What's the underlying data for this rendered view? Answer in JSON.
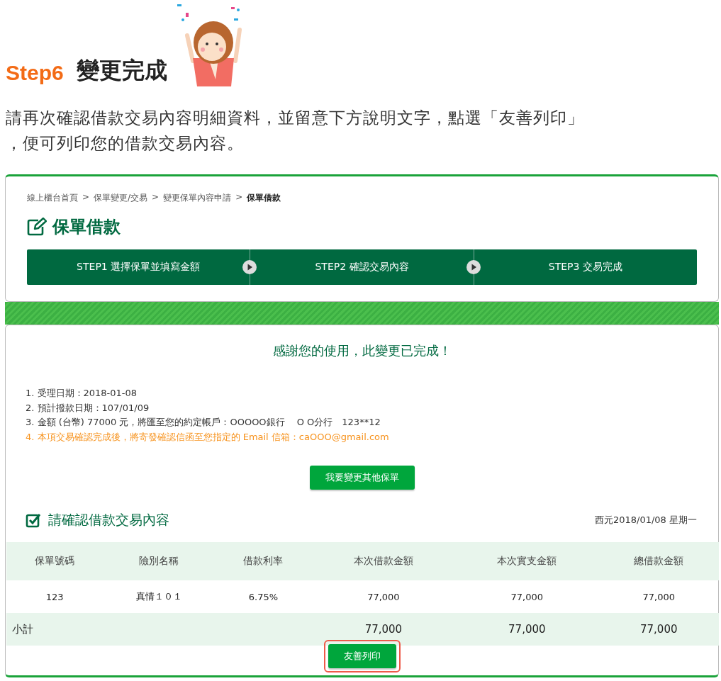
{
  "header": {
    "step": "Step6",
    "title": "變更完成",
    "intro_lines": [
      "請再次確認借款交易內容明細資料，並留意下方說明文字，點選「友善列印」",
      "，便可列印您的借款交易內容。"
    ]
  },
  "breadcrumb": [
    {
      "label": "線上櫃台首頁",
      "current": false
    },
    {
      "label": ">",
      "current": false
    },
    {
      "label": "保單變更/交易",
      "current": false
    },
    {
      "label": ">",
      "current": false
    },
    {
      "label": "變更保單內容申請",
      "current": false
    },
    {
      "label": ">",
      "current": false
    },
    {
      "label": "保單借款",
      "current": true
    }
  ],
  "page_title": "保單借款",
  "steps": [
    "STEP1 選擇保單並填寫金額",
    "STEP2 確認交易內容",
    "STEP3 交易完成"
  ],
  "done_message": "感謝您的使用，此變更已完成！",
  "notes": [
    {
      "text": "1. 受理日期：2018-01-08",
      "kind": "normal"
    },
    {
      "text": "2. 預計撥款日期：107/01/09",
      "kind": "normal"
    },
    {
      "text": "3. 金額 (台幣) 77000 元，將匯至您的約定帳戶：OOOOO銀行　 O O分行　123**12",
      "kind": "normal"
    },
    {
      "text": "4. 本項交易確認完成後，將寄發確認信函至您指定的 Email 信箱：caOOO@gmail.com",
      "kind": "notice"
    }
  ],
  "change_button": "我要變更其他保單",
  "confirm_title": "請確認借款交易內容",
  "date": "西元2018/01/08 星期一",
  "table": {
    "columns": [
      "保單號碼",
      "險別名稱",
      "借款利率",
      "本次借款金額",
      "本次實支金額",
      "總借款金額"
    ],
    "rows": [
      [
        "123",
        "真情１０１",
        "6.75%",
        "77,000",
        "77,000",
        "77,000"
      ]
    ],
    "subtotal": {
      "label": "小計",
      "values": [
        "77,000",
        "77,000",
        "77,000"
      ]
    }
  },
  "print_button": {
    "label": "友善列印",
    "highlighted": true
  }
}
